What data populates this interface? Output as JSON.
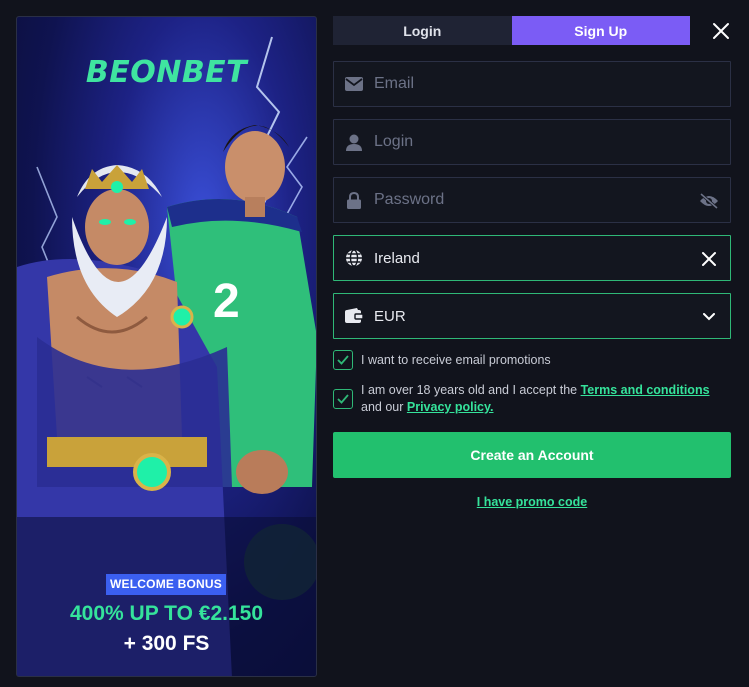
{
  "banner": {
    "logo_text": "BEONBET",
    "welcome_badge": "WELCOME BONUS",
    "bonus_line1": "400% UP TO €2.150",
    "bonus_line2": "+ 300 FS",
    "jersey_number": "2"
  },
  "tabs": [
    {
      "label": "Login",
      "active": false
    },
    {
      "label": "Sign Up",
      "active": true
    }
  ],
  "form": {
    "email": {
      "placeholder": "Email",
      "icon": "envelope-icon"
    },
    "login": {
      "placeholder": "Login",
      "icon": "user-icon"
    },
    "password": {
      "placeholder": "Password",
      "icon": "lock-icon",
      "toggle_icon": "eye-slash-icon"
    },
    "country": {
      "value": "Ireland",
      "icon": "globe-icon",
      "clear_icon": "close-icon"
    },
    "currency": {
      "value": "EUR",
      "icon": "wallet-icon",
      "dropdown_icon": "chevron-down-icon"
    }
  },
  "checkboxes": {
    "promotions": {
      "checked": true,
      "label": "I want to receive email promotions"
    },
    "terms": {
      "checked": true,
      "text_before": "I am over 18 years old and I accept the ",
      "terms_link": "Terms and conditions",
      "text_middle": " and our ",
      "privacy_link": "Privacy policy."
    }
  },
  "buttons": {
    "create_account": "Create an Account",
    "promo_code": "I have promo code"
  },
  "colors": {
    "background": "#11131c",
    "accent_green": "#22c06e",
    "tab_active": "#7b5cf5",
    "badge_blue": "#3b5ff0"
  }
}
